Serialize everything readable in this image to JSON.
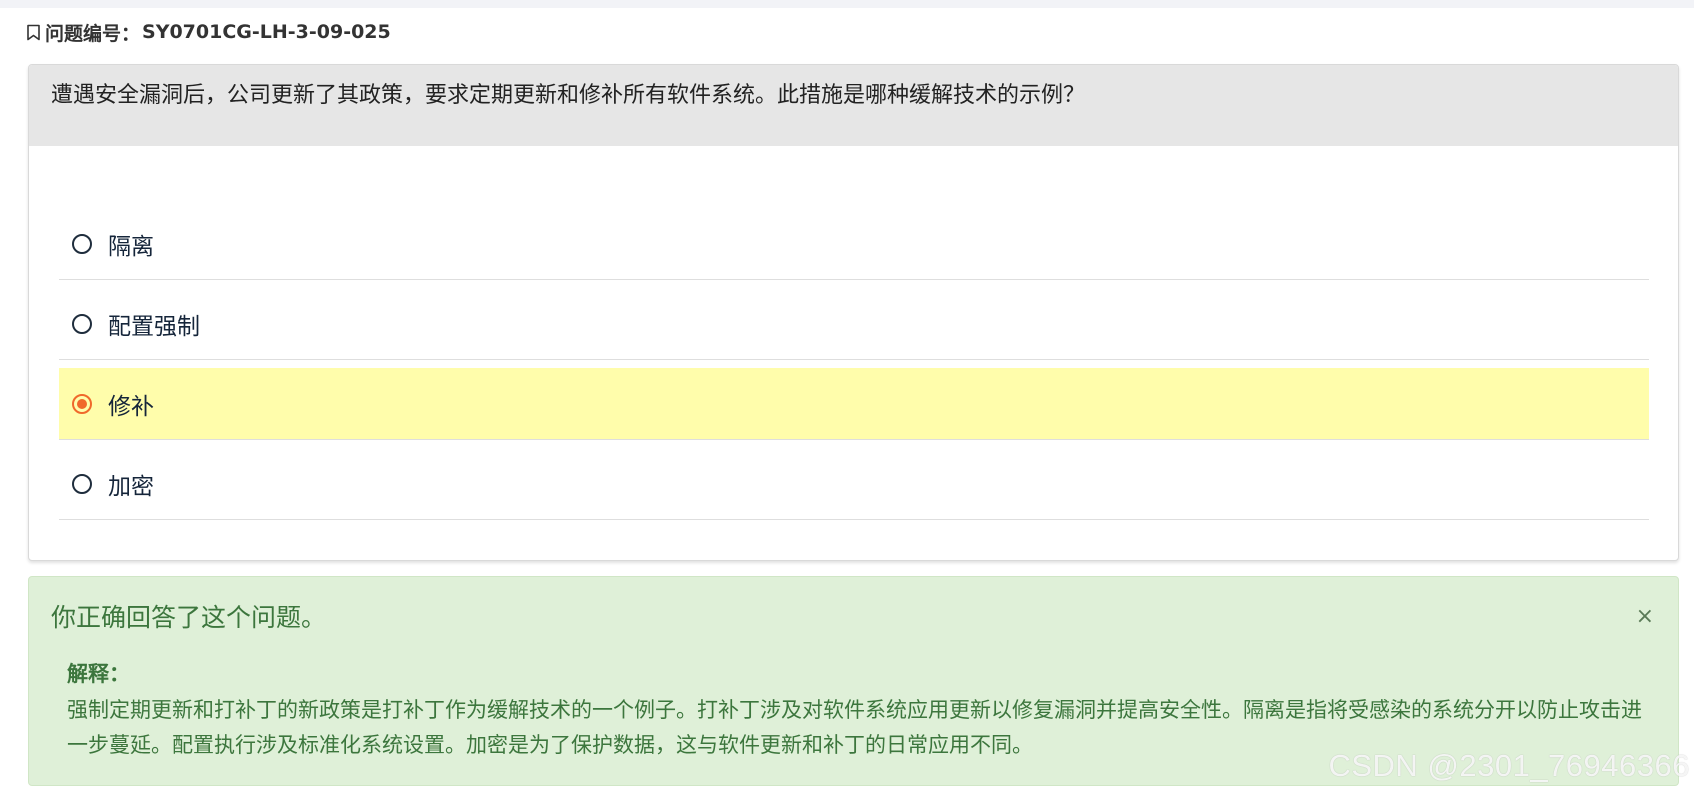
{
  "question": {
    "id_label": "问题编号：",
    "id_value": "SY0701CG-LH-3-09-025",
    "text": "遭遇安全漏洞后，公司更新了其政策，要求定期更新和修补所有软件系统。此措施是哪种缓解技术的示例？"
  },
  "options": [
    {
      "label": "隔离",
      "selected": false
    },
    {
      "label": "配置强制",
      "selected": false
    },
    {
      "label": "修补",
      "selected": true
    },
    {
      "label": "加密",
      "selected": false
    }
  ],
  "result": {
    "title": "你正确回答了这个问题。",
    "close_label": "×",
    "explanation_label": "解释：",
    "explanation_text": "强制定期更新和打补丁的新政策是打补丁作为缓解技术的一个例子。打补丁涉及对软件系统应用更新以修复漏洞并提高安全性。隔离是指将受感染的系统分开以防止攻击进一步蔓延。配置执行涉及标准化系统设置。加密是为了保护数据，这与软件更新和补丁的日常应用不同。"
  },
  "watermark": "CSDN @2301_76946366",
  "colors": {
    "selected_highlight": "#fffdab",
    "radio_checked": "#f0692b",
    "success_bg": "#dff0d8",
    "success_text": "#3c763d",
    "header_bg": "#e6e6e6"
  },
  "icons": {
    "question_id": "bookmark-icon",
    "close": "close-icon"
  }
}
